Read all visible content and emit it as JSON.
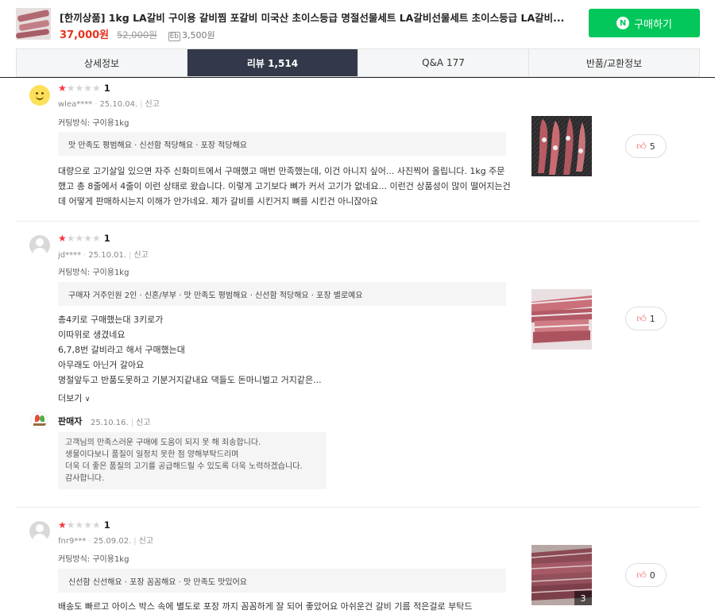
{
  "product": {
    "title": "[한끼상품] 1kg LA갈비 구이용 갈비찜 포갈비 미국산 초이스등급 명절선물세트 LA갈비선물세트 초이스등급 LA갈비...",
    "price": "37,000원",
    "original_price": "52,000원",
    "points_icon": "Eb",
    "points": "3,500원",
    "buy_label": "구매하기",
    "buy_logo": "N"
  },
  "tabs": [
    {
      "label": "상세정보"
    },
    {
      "label": "리뷰 1,514"
    },
    {
      "label": "Q&A 177"
    },
    {
      "label": "반품/교환정보"
    }
  ],
  "reviews": [
    {
      "rating": "1",
      "user": "wlea****",
      "date": "25.10.04.",
      "report": "신고",
      "option": "커팅방식: 구이용1kg",
      "tags": "맛 만족도 평범해요 · 신선함 적당해요 · 포장 적당해요",
      "body": [
        "대량으로 고기살일 있으면 자주 신화미트에서 구매했고 매번 만족했는데, 이건 아니지 싶어... 사진찍어 올립니다. 1kg 주문했고 총 8줄에서 4줄이 이런 상태로 왔습니다. 이렇게 고기보다 뼈가 커서 고기가 없네요... 이런건 상품성이 많이 떨어지는건데 어떻게 판매하시는지 이해가 안가네요. 제가 갈비를 시킨거지 뼈를 시킨건 아니잖아요"
      ],
      "likes": "5"
    },
    {
      "rating": "1",
      "user": "jd****",
      "date": "25.10.01.",
      "report": "신고",
      "option": "커팅방식: 구이용1kg",
      "tags": "구매자 거주인원 2인 · 신혼/부부 · 맛 만족도 평범해요 · 신선함 적당해요 · 포장 별로예요",
      "body": [
        "총4키로 구매했는대  3키로가",
        "이따위로 생겼네요",
        "6,7,8번 갈비라고 해서 구매했는대",
        "아무래도  아닌거 갈아요",
        "명절앞두고  반품도못하고 기분거지같내요 댁들도  돈마니벌고 거지같은..."
      ],
      "more": "더보기",
      "likes": "1",
      "seller": {
        "name": "판매자",
        "date": "25.10.16.",
        "report": "신고",
        "reply": [
          "고객님의 만족스러운 구매에 도움이 되지 못 해 죄송합니다.",
          "생물이다보니 품질이 일정치 못한 점 양해부탁드리며",
          "더욱 더 좋은 품질의 고기를 공급해드릴 수 있도록 더욱 노력하겠습니다.",
          "감사합니다."
        ]
      }
    },
    {
      "rating": "1",
      "user": "fnr9***",
      "date": "25.09.02.",
      "report": "신고",
      "option": "커팅방식: 구이용1kg",
      "tags": "신선함 신선해요 · 포장 꼼꼼해요 · 맛 만족도 맛있어요",
      "body": [
        "배송도 빠르고  아이스 박스 속에 별도로 포장 까지 꼼꼼하게 잘 되어 좋았어요 아쉬운건 갈비 기름 적은걸로 부탁드"
      ],
      "photo_count": "3",
      "likes": "0"
    }
  ]
}
